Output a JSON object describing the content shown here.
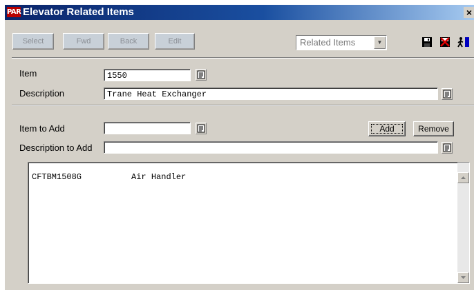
{
  "window": {
    "icon_text": "PAR",
    "title": "Elevator Related Items",
    "close_label": "×"
  },
  "toolbar": {
    "buttons": [
      {
        "label": "Select"
      },
      {
        "label": "Fwd"
      },
      {
        "label": "Back"
      },
      {
        "label": "Edit"
      }
    ],
    "view_dropdown": {
      "value": "Related Items"
    },
    "icons": [
      "save-icon",
      "delete-icon",
      "exit-icon"
    ]
  },
  "header": {
    "item_label": "Item",
    "item_value": "1550",
    "description_label": "Description",
    "description_value": "Trane Heat Exchanger"
  },
  "add_form": {
    "item_to_add_label": "Item to Add",
    "item_to_add_value": "",
    "description_to_add_label": "Description to Add",
    "description_to_add_value": "",
    "add_button": "Add",
    "remove_button": "Remove"
  },
  "related_items": [
    {
      "item": "CFTBM1508G",
      "description": "Air Handler"
    }
  ],
  "colors": {
    "title_start": "#0a246a",
    "title_end": "#a6caf0",
    "window_bg": "#d4d0c8",
    "app_icon": "#b80000"
  }
}
